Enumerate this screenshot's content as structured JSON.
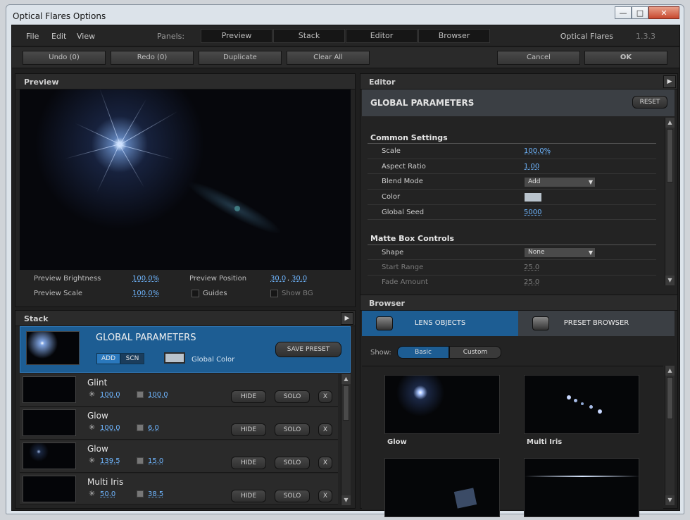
{
  "window": {
    "title": "Optical Flares Options",
    "controls": [
      "—",
      "□",
      "✕"
    ]
  },
  "menubar": {
    "menus": [
      "File",
      "Edit",
      "View"
    ],
    "panels_label": "Panels:",
    "panel_tabs": [
      "Preview",
      "Stack",
      "Editor",
      "Browser"
    ],
    "brand": "Optical Flares",
    "version": "1.3.3"
  },
  "toolbar": {
    "undo": "Undo (0)",
    "redo": "Redo (0)",
    "duplicate": "Duplicate",
    "clear_all": "Clear All",
    "cancel": "Cancel",
    "ok": "OK"
  },
  "preview": {
    "header": "Preview",
    "brightness_label": "Preview Brightness",
    "brightness_value": "100.0%",
    "scale_label": "Preview Scale",
    "scale_value": "100.0%",
    "position_label": "Preview Position",
    "position_x": "30.0",
    "position_sep": ",",
    "position_y": "30.0",
    "guides_label": "Guides",
    "show_bg_label": "Show BG"
  },
  "stack": {
    "header": "Stack",
    "global": {
      "title": "GLOBAL PARAMETERS",
      "add": "ADD",
      "scn": "SCN",
      "color_label": "Global Color",
      "save_preset": "SAVE PRESET"
    },
    "layers": [
      {
        "name": "Glint",
        "brightness": "100.0",
        "scale": "100.0"
      },
      {
        "name": "Glow",
        "brightness": "100.0",
        "scale": "6.0"
      },
      {
        "name": "Glow",
        "brightness": "139.5",
        "scale": "15.0"
      },
      {
        "name": "Multi Iris",
        "brightness": "50.0",
        "scale": "38.5"
      }
    ],
    "hide": "HIDE",
    "solo": "SOLO",
    "x": "X"
  },
  "editor": {
    "header": "Editor",
    "title": "GLOBAL PARAMETERS",
    "reset": "RESET",
    "common": {
      "section": "Common Settings",
      "scale_label": "Scale",
      "scale_value": "100.0%",
      "aspect_label": "Aspect Ratio",
      "aspect_value": "1.00",
      "blend_label": "Blend Mode",
      "blend_value": "Add",
      "color_label": "Color",
      "seed_label": "Global Seed",
      "seed_value": "5000"
    },
    "matte": {
      "section": "Matte Box Controls",
      "shape_label": "Shape",
      "shape_value": "None",
      "start_label": "Start Range",
      "start_value": "25.0",
      "fade_label": "Fade Amount",
      "fade_value": "25.0"
    }
  },
  "browser": {
    "header": "Browser",
    "tab_lens": "LENS OBJECTS",
    "tab_preset": "PRESET BROWSER",
    "show_label": "Show:",
    "basic": "Basic",
    "custom": "Custom",
    "tiles": [
      "Glow",
      "Multi Iris"
    ]
  },
  "colors": {
    "accent_blue": "#1d5d93",
    "link_blue": "#6fb6ff",
    "panel": "#232323"
  }
}
